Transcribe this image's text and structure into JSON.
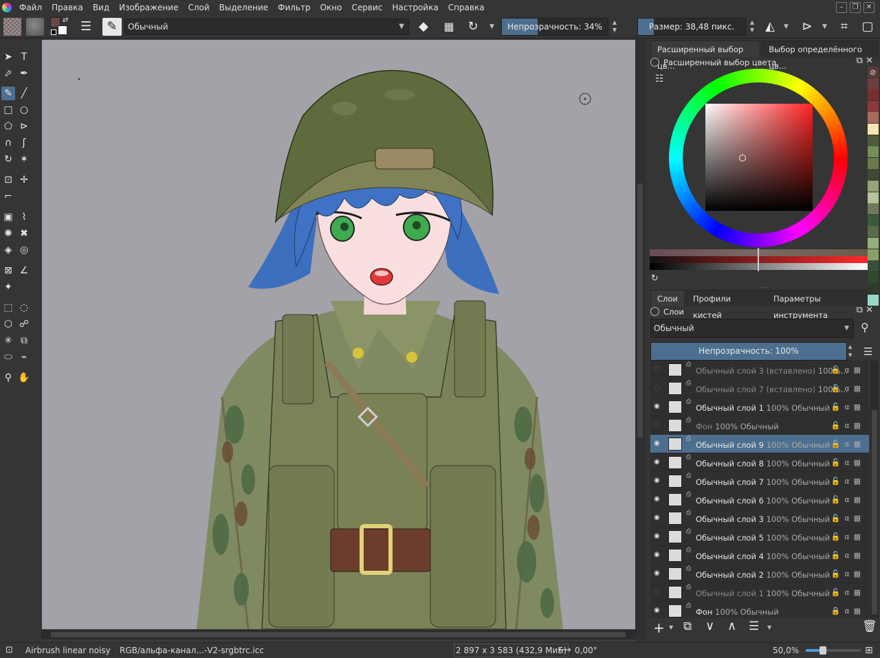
{
  "menu": [
    "Файл",
    "Правка",
    "Вид",
    "Изображение",
    "Слой",
    "Выделение",
    "Фильтр",
    "Окно",
    "Сервис",
    "Настройка",
    "Справка"
  ],
  "toolbar": {
    "blend_mode": "Обычный",
    "opacity_label": "Непрозрачность: 34%",
    "opacity_value": 0.34,
    "size_label": "Размер: 38,48 пикс.",
    "size_fill": 0.15
  },
  "colors": {
    "accent": "#4d6f8f",
    "foreground": "#6b4848",
    "background": "#ffffff"
  },
  "color_docker": {
    "tabs": [
      "Расширенный выбор цв...",
      "Выбор определённого цв..."
    ],
    "title": "Расширенный выбор цвета"
  },
  "palette": [
    "#5a3a3a",
    "#6b3f3f",
    "#7a2f2f",
    "#8a3a3a",
    "#a86a5a",
    "#f4e6b0",
    "#4f5a3a",
    "#788c5a",
    "#6a7a4a",
    "#3f4a35",
    "#96a47a",
    "#b4c49a",
    "#707a5a",
    "#3a5a3a",
    "#5a6a4a",
    "#95b07a",
    "#8aa06a",
    "#3a4f3a",
    "#2f4a2f",
    "#2f3a2a",
    "#9bd6c8"
  ],
  "dock_tabs2": [
    "Слои",
    "Профили кистей",
    "Параметры инструмента"
  ],
  "layers_panel": {
    "title": "Слои",
    "blend_mode": "Обычный",
    "opacity_label": "Непрозрачность:  100%",
    "opacity_value": 1.0
  },
  "layers": [
    {
      "name": "Обычный слой 3 (вставлено)",
      "meta": "100%...",
      "visible": false,
      "selected": false,
      "locked": false
    },
    {
      "name": "Обычный слой 7 (вставлено)",
      "meta": "100%...",
      "visible": false,
      "selected": false,
      "locked": false
    },
    {
      "name": "Обычный слой 1",
      "meta": "100% Обычный",
      "visible": true,
      "selected": false,
      "locked": false
    },
    {
      "name": "Фон",
      "meta": "100% Обычный",
      "visible": false,
      "selected": false,
      "locked": false
    },
    {
      "name": "Обычный слой 9",
      "meta": "100% Обычный",
      "visible": true,
      "selected": true,
      "locked": false
    },
    {
      "name": "Обычный слой 8",
      "meta": "100% Обычный",
      "visible": true,
      "selected": false,
      "locked": false
    },
    {
      "name": "Обычный слой 7",
      "meta": "100% Обычный",
      "visible": true,
      "selected": false,
      "locked": false
    },
    {
      "name": "Обычный слой 6",
      "meta": "100% Обычный",
      "visible": true,
      "selected": false,
      "locked": false
    },
    {
      "name": "Обычный слой 3",
      "meta": "100% Обычный",
      "visible": true,
      "selected": false,
      "locked": false
    },
    {
      "name": "Обычный слой 5",
      "meta": "100% Обычный",
      "visible": true,
      "selected": false,
      "locked": false
    },
    {
      "name": "Обычный слой 4",
      "meta": "100% Обычный",
      "visible": true,
      "selected": false,
      "locked": false
    },
    {
      "name": "Обычный слой 2",
      "meta": "100% Обычный",
      "visible": true,
      "selected": false,
      "locked": false
    },
    {
      "name": "Обычный слой 1",
      "meta": "100% Обычный",
      "visible": false,
      "selected": false,
      "locked": false
    },
    {
      "name": "Фон",
      "meta": "100% Обычный",
      "visible": true,
      "selected": false,
      "locked": true
    }
  ],
  "status": {
    "brush": "Airbrush linear noisy",
    "profile": "RGB/альфа-канал...-V2-srgbtrc.icc",
    "dimensions": "2 897 x 3 583 (432,9 МиБ)",
    "rotation": "0,00°",
    "zoom": "50,0%"
  }
}
